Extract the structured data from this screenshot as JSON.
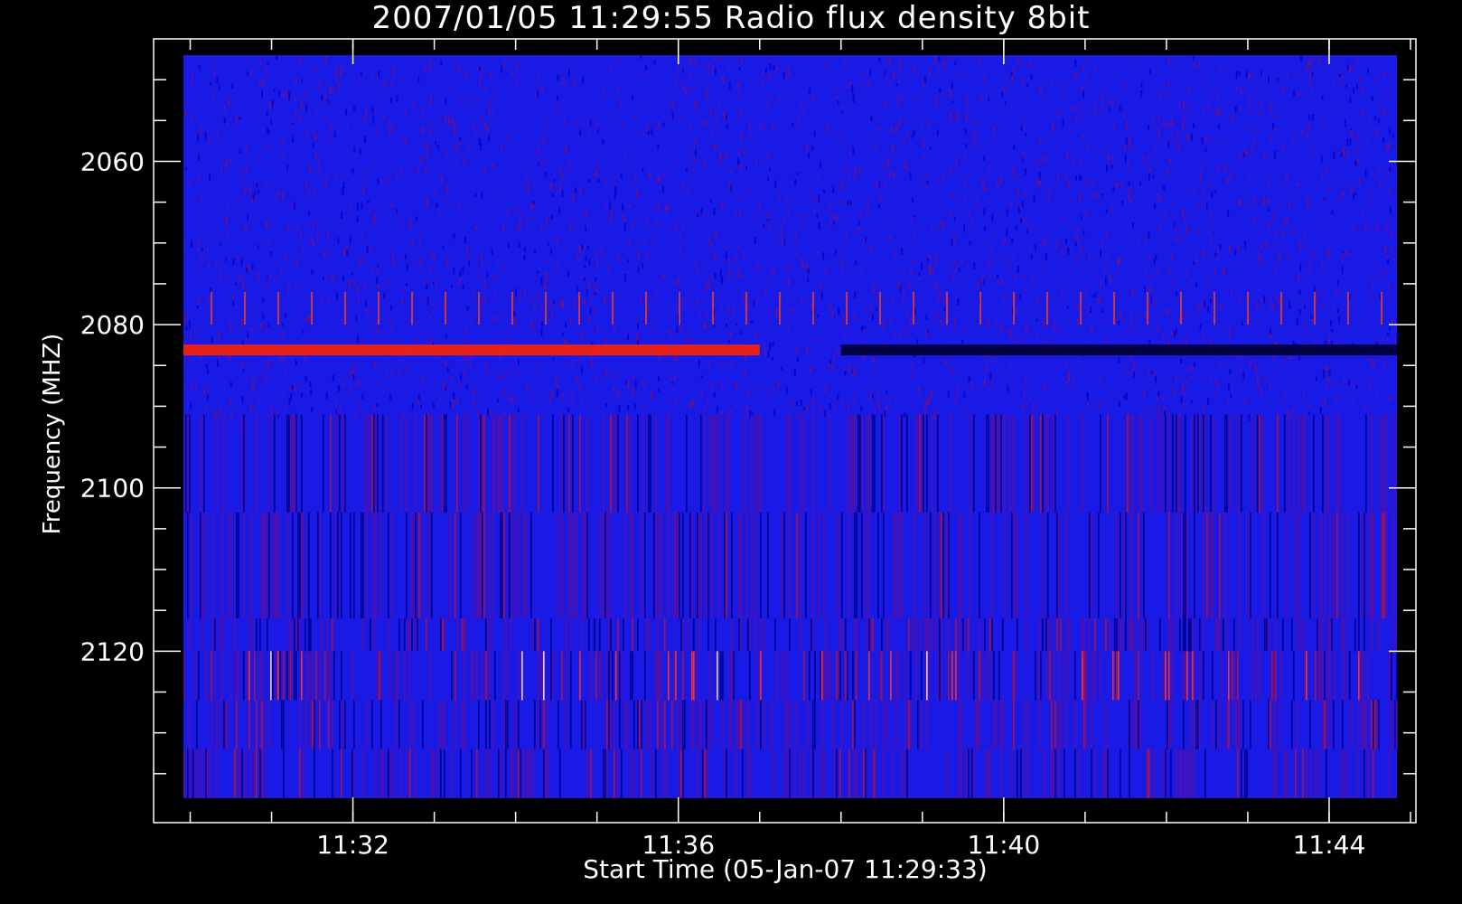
{
  "chart_data": {
    "type": "heatmap",
    "title": "2007/01/05 11:29:55 Radio flux density 8bit",
    "xlabel": "Start Time (05-Jan-07 11:29:33)",
    "ylabel": "Frequency (MHZ)",
    "x_tick_labels": [
      "11:32",
      "11:36",
      "11:40",
      "11:44"
    ],
    "x_ticks_minutes": [
      32,
      36,
      40,
      44
    ],
    "x_axis_range": [
      "11:29:33",
      "11:45:04"
    ],
    "y_tick_labels": [
      "2060",
      "2080",
      "2100",
      "2120"
    ],
    "y_ticks": [
      2060,
      2080,
      2100,
      2120
    ],
    "y_axis_range": [
      2045,
      2141
    ],
    "y_inverted": true,
    "data_extent": {
      "time_start": "11:29:55",
      "time_end": "11:44:50",
      "freq_top": 2047,
      "freq_bottom": 2138
    },
    "colormap": [
      "#000000",
      "#0000ff",
      "#ff0000",
      "#ffffff"
    ],
    "features": [
      {
        "kind": "horizontal-band",
        "freq": 2083,
        "time_start": "11:29:55",
        "time_end": "11:37:00",
        "color": "#ff2200"
      },
      {
        "kind": "horizontal-band",
        "freq": 2083,
        "time_start": "11:38:00",
        "time_end": "11:44:50",
        "color": "#000030"
      },
      {
        "kind": "periodic-bursts",
        "freq_start": 2076,
        "freq_end": 2080
      }
    ]
  }
}
